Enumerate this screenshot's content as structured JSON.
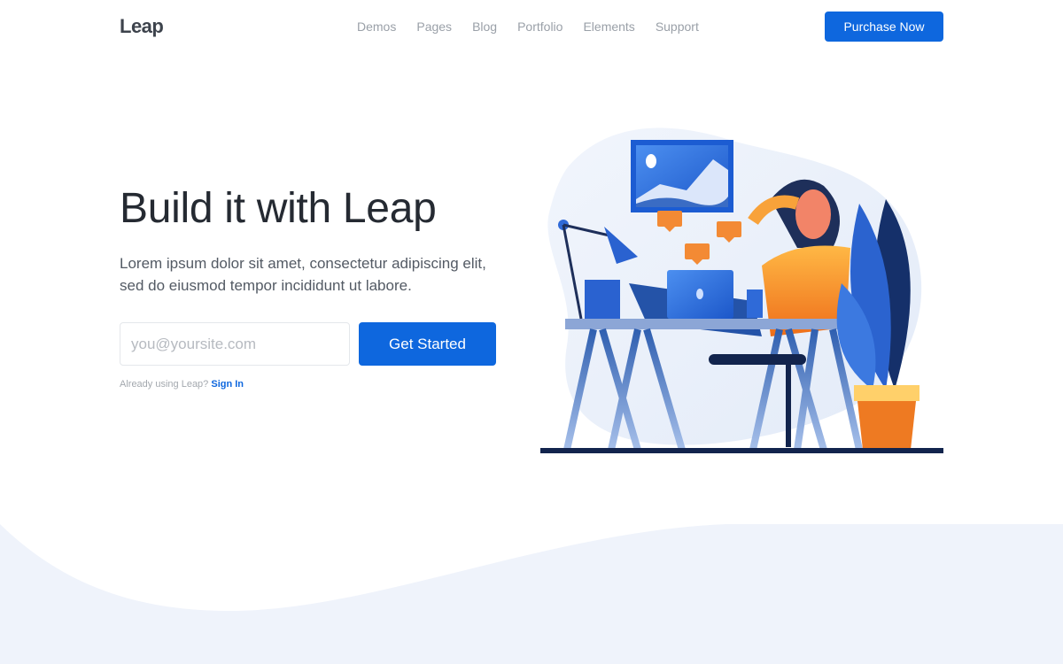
{
  "brand": {
    "name": "Leap",
    "accent": "#0e67de"
  },
  "nav": {
    "items": [
      {
        "label": "Demos"
      },
      {
        "label": "Pages"
      },
      {
        "label": "Blog"
      },
      {
        "label": "Portfolio"
      },
      {
        "label": "Elements"
      },
      {
        "label": "Support"
      }
    ],
    "cta_label": "Purchase Now"
  },
  "hero": {
    "title": "Build it with Leap",
    "subtitle": "Lorem ipsum dolor sit amet, consectetur adipiscing elit, sed do eiusmod tempor incididunt ut labore.",
    "email_placeholder": "you@yoursite.com",
    "email_value": "",
    "cta_label": "Get Started",
    "already_text": "Already using Leap?",
    "signin_label": "Sign In"
  },
  "illustration": {
    "subject": "person relaxing at desk with laptop, lamp, picture frame and plant"
  }
}
